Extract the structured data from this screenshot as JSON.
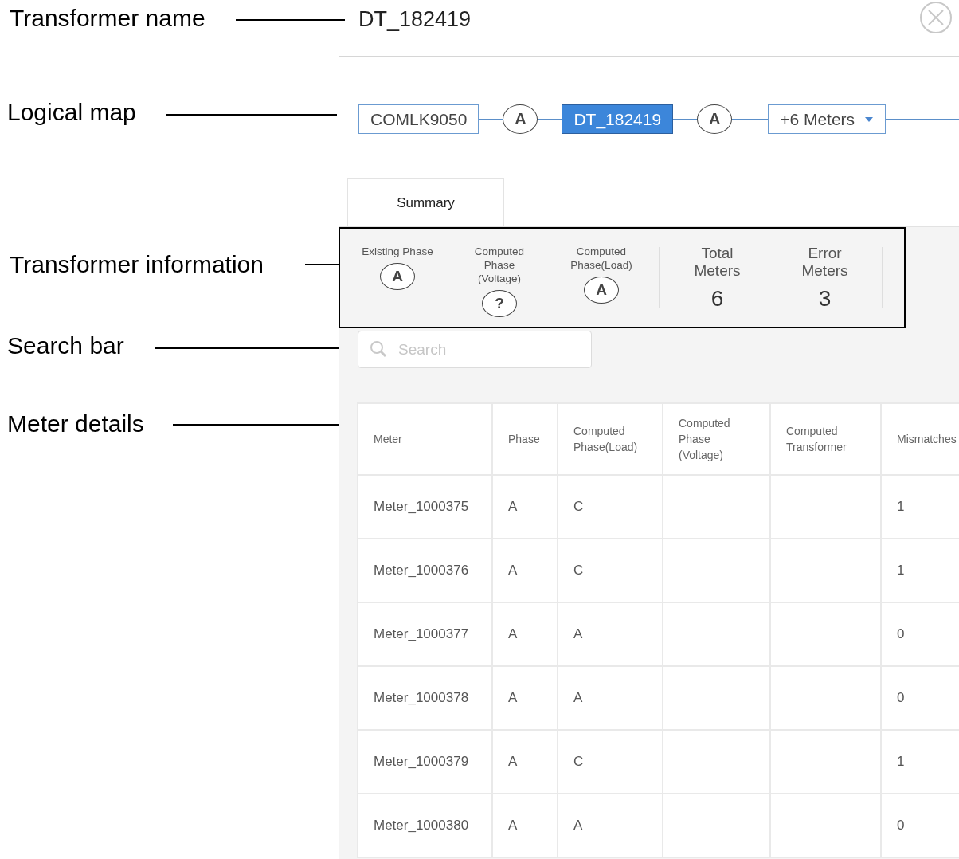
{
  "annotations": [
    "Transformer name",
    "Logical map",
    "Transformer information",
    "Search bar",
    "Meter details"
  ],
  "transformer_name": "DT_182419",
  "logical_map": {
    "nodes": [
      {
        "kind": "box",
        "label": "COMLK9050",
        "selected": false
      },
      {
        "kind": "phase",
        "label": "A"
      },
      {
        "kind": "box",
        "label": "DT_182419",
        "selected": true
      },
      {
        "kind": "phase",
        "label": "A"
      },
      {
        "kind": "dropdown",
        "label": "+6 Meters"
      }
    ]
  },
  "tabs": [
    {
      "label": "Summary",
      "selected": true
    }
  ],
  "summary": {
    "phases": [
      {
        "label": "Existing Phase",
        "value": "A"
      },
      {
        "label": "Computed Phase (Voltage)",
        "value": "?"
      },
      {
        "label": "Computed Phase(Load)",
        "value": "A"
      }
    ],
    "stats": [
      {
        "label": "Total Meters",
        "value": "6"
      },
      {
        "label": "Error Meters",
        "value": "3"
      }
    ]
  },
  "search": {
    "placeholder": "Search"
  },
  "table": {
    "columns": [
      "Meter",
      "Phase",
      "Computed Phase(Load)",
      "Computed Phase (Voltage)",
      "Computed Transformer",
      "Mismatches"
    ],
    "rows": [
      [
        "Meter_1000375",
        "A",
        "C",
        "",
        "",
        "1"
      ],
      [
        "Meter_1000376",
        "A",
        "C",
        "",
        "",
        "1"
      ],
      [
        "Meter_1000377",
        "A",
        "A",
        "",
        "",
        "0"
      ],
      [
        "Meter_1000378",
        "A",
        "A",
        "",
        "",
        "0"
      ],
      [
        "Meter_1000379",
        "A",
        "C",
        "",
        "",
        "1"
      ],
      [
        "Meter_1000380",
        "A",
        "A",
        "",
        "",
        "0"
      ]
    ]
  }
}
